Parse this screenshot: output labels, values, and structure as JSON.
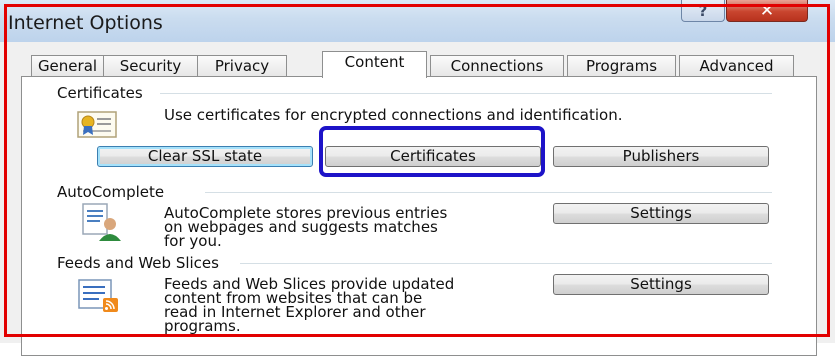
{
  "window": {
    "title": "Internet Options",
    "help_label": "?",
    "close_label": "✕"
  },
  "tabs": [
    {
      "label": "General"
    },
    {
      "label": "Security"
    },
    {
      "label": "Privacy"
    },
    {
      "label": "Content",
      "active": true
    },
    {
      "label": "Connections"
    },
    {
      "label": "Programs"
    },
    {
      "label": "Advanced"
    }
  ],
  "certificates": {
    "heading": "Certificates",
    "description": "Use certificates for encrypted connections and identification.",
    "clear_ssl_label": "Clear SSL state",
    "certificates_label": "Certificates",
    "publishers_label": "Publishers",
    "icon": "certificate-icon"
  },
  "autocomplete": {
    "heading": "AutoComplete",
    "description_lines": [
      "AutoComplete stores previous entries",
      "on webpages and suggests matches",
      "for you."
    ],
    "settings_label": "Settings",
    "icon": "autocomplete-icon"
  },
  "feeds": {
    "heading": "Feeds and Web Slices",
    "description_lines": [
      "Feeds and Web Slices provide updated",
      "content from websites that can be",
      "read in Internet Explorer and other",
      "programs."
    ],
    "settings_label": "Settings",
    "icon": "feeds-icon"
  },
  "colors": {
    "highlight_outer": "#e20000",
    "highlight_button": "#1d13c8"
  }
}
